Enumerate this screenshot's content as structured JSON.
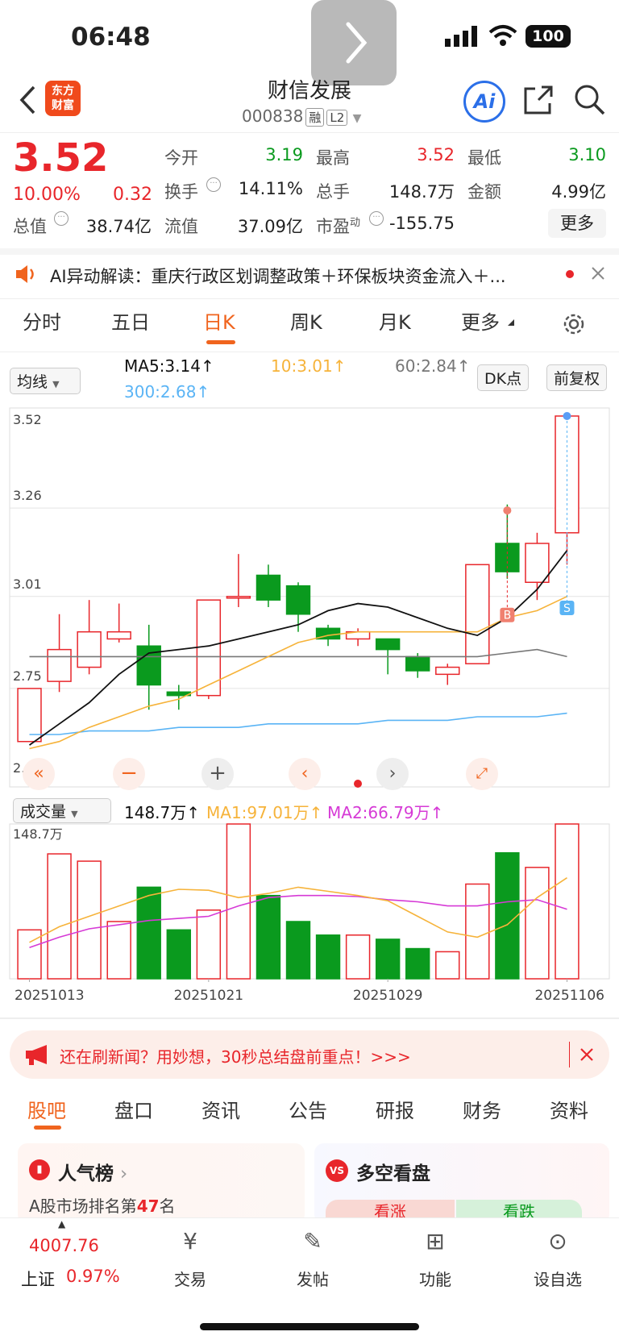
{
  "status": {
    "time": "06:48",
    "battery": "100"
  },
  "header": {
    "logo_line1": "东方",
    "logo_line2": "财富",
    "title": "财信发展",
    "code": "000838",
    "tag1": "融",
    "tag2": "L2",
    "ai_label": "Ai"
  },
  "quote": {
    "price": "3.52",
    "pct": "10.00%",
    "change": "0.32",
    "cap_label": "总值",
    "cap": "38.74亿",
    "open_label": "今开",
    "open": "3.19",
    "turnover_label": "换手",
    "turnover": "14.11%",
    "float_label": "流值",
    "float": "37.09亿",
    "high_label": "最高",
    "high": "3.52",
    "vol_label": "总手",
    "vol": "148.7万",
    "pe_label": "市盈",
    "pe_sup": "动",
    "pe": "-155.75",
    "low_label": "最低",
    "low": "3.10",
    "amount_label": "金额",
    "amount": "4.99亿",
    "more": "更多"
  },
  "ai_notice": {
    "text": "AI异动解读：重庆行政区划调整政策＋环保板块资金流入＋..."
  },
  "tabs": [
    "分时",
    "五日",
    "日K",
    "周K",
    "月K",
    "更多"
  ],
  "kline_controls": {
    "ma_select": "均线",
    "ma5": "MA5:3.14",
    "ma10": "10:3.01",
    "ma60": "60:2.84",
    "ma300": "300:2.68",
    "dk": "DK点",
    "adjust": "前复权",
    "vol_select": "成交量",
    "vol_val": "148.7万",
    "vma1": "MA1:97.01万",
    "vma2": "MA2:66.79万",
    "vol_top": "148.7万"
  },
  "colors": {
    "up": "#e8262b",
    "down": "#0a9a1e",
    "ma5": "#111111",
    "ma10": "#f6b33a",
    "ma60": "#777777",
    "ma300": "#5ab4f5",
    "vma2": "#d63ad6",
    "accent": "#f0641e"
  },
  "chart_data": {
    "type": "candlestick",
    "y_ticks": [
      "3.52",
      "3.26",
      "3.01",
      "2.75",
      "2.49"
    ],
    "ylim": [
      2.49,
      3.52
    ],
    "x_ticks": [
      "20251013",
      "20251021",
      "20251029",
      "20251106"
    ],
    "candles": [
      {
        "o": 2.6,
        "c": 2.75,
        "h": 2.75,
        "l": 2.6
      },
      {
        "o": 2.77,
        "c": 2.86,
        "h": 2.96,
        "l": 2.74
      },
      {
        "o": 2.81,
        "c": 2.91,
        "h": 3.0,
        "l": 2.79
      },
      {
        "o": 2.89,
        "c": 2.91,
        "h": 2.99,
        "l": 2.88
      },
      {
        "o": 2.87,
        "c": 2.76,
        "h": 2.93,
        "l": 2.69
      },
      {
        "o": 2.74,
        "c": 2.73,
        "h": 2.76,
        "l": 2.69
      },
      {
        "o": 2.73,
        "c": 3.0,
        "h": 3.0,
        "l": 2.72
      },
      {
        "o": 3.01,
        "c": 3.01,
        "h": 3.13,
        "l": 2.98
      },
      {
        "o": 3.07,
        "c": 3.0,
        "h": 3.1,
        "l": 2.98
      },
      {
        "o": 3.04,
        "c": 2.96,
        "h": 3.05,
        "l": 2.91
      },
      {
        "o": 2.92,
        "c": 2.89,
        "h": 2.93,
        "l": 2.87
      },
      {
        "o": 2.89,
        "c": 2.91,
        "h": 2.92,
        "l": 2.87
      },
      {
        "o": 2.89,
        "c": 2.86,
        "h": 2.89,
        "l": 2.79
      },
      {
        "o": 2.84,
        "c": 2.8,
        "h": 2.85,
        "l": 2.78
      },
      {
        "o": 2.79,
        "c": 2.81,
        "h": 2.82,
        "l": 2.76
      },
      {
        "o": 2.82,
        "c": 3.1,
        "h": 3.1,
        "l": 2.82
      },
      {
        "o": 3.16,
        "c": 3.08,
        "h": 3.27,
        "l": 3.06
      },
      {
        "o": 3.05,
        "c": 3.16,
        "h": 3.19,
        "l": 3.0
      },
      {
        "o": 3.19,
        "c": 3.52,
        "h": 3.52,
        "l": 3.1
      }
    ],
    "ma5": [
      2.59,
      2.65,
      2.71,
      2.79,
      2.85,
      2.86,
      2.87,
      2.89,
      2.91,
      2.93,
      2.97,
      2.99,
      2.98,
      2.95,
      2.92,
      2.9,
      2.95,
      3.03,
      3.14
    ],
    "ma10": [
      2.58,
      2.6,
      2.64,
      2.67,
      2.7,
      2.72,
      2.76,
      2.8,
      2.84,
      2.88,
      2.9,
      2.91,
      2.91,
      2.91,
      2.91,
      2.91,
      2.95,
      2.97,
      3.01
    ],
    "ma60": [
      2.84,
      2.84,
      2.84,
      2.84,
      2.84,
      2.84,
      2.84,
      2.84,
      2.84,
      2.84,
      2.84,
      2.84,
      2.84,
      2.84,
      2.84,
      2.84,
      2.85,
      2.86,
      2.84
    ],
    "ma300": [
      2.62,
      2.62,
      2.63,
      2.63,
      2.63,
      2.64,
      2.64,
      2.64,
      2.65,
      2.65,
      2.65,
      2.65,
      2.66,
      2.66,
      2.66,
      2.67,
      2.67,
      2.67,
      2.68
    ],
    "volumes": [
      47,
      120,
      113,
      55,
      88,
      47,
      66,
      148.7,
      80,
      55,
      42,
      42,
      38,
      29,
      26,
      91,
      121,
      107,
      148.7
    ],
    "vma1": [
      35,
      50,
      60,
      70,
      80,
      86,
      85,
      78,
      82,
      88,
      84,
      80,
      75,
      60,
      45,
      40,
      52,
      78,
      97.01
    ],
    "vma2": [
      30,
      40,
      48,
      52,
      56,
      58,
      60,
      70,
      78,
      80,
      80,
      79,
      76,
      74,
      70,
      70,
      74,
      76,
      66.79
    ],
    "markers": {
      "B": "B",
      "S": "S"
    }
  },
  "notice_bar": {
    "text": "还在刷新闻？用妙想，30秒总结盘前重点！>>>"
  },
  "section_tabs": [
    "股吧",
    "盘口",
    "资讯",
    "公告",
    "研报",
    "财务",
    "资料"
  ],
  "cards": {
    "rank_title": "人气榜",
    "rank_text_pre": "A股市场排名第",
    "rank_num": "47",
    "rank_text_post": "名",
    "bull_title": "多空看盘",
    "bull": "看涨",
    "bear": "看跌"
  },
  "bottom": {
    "index_val": "4007.76",
    "index_name": "上证",
    "index_pct": "0.97%",
    "trade": "交易",
    "post": "发帖",
    "func": "功能",
    "watch": "设自选"
  }
}
